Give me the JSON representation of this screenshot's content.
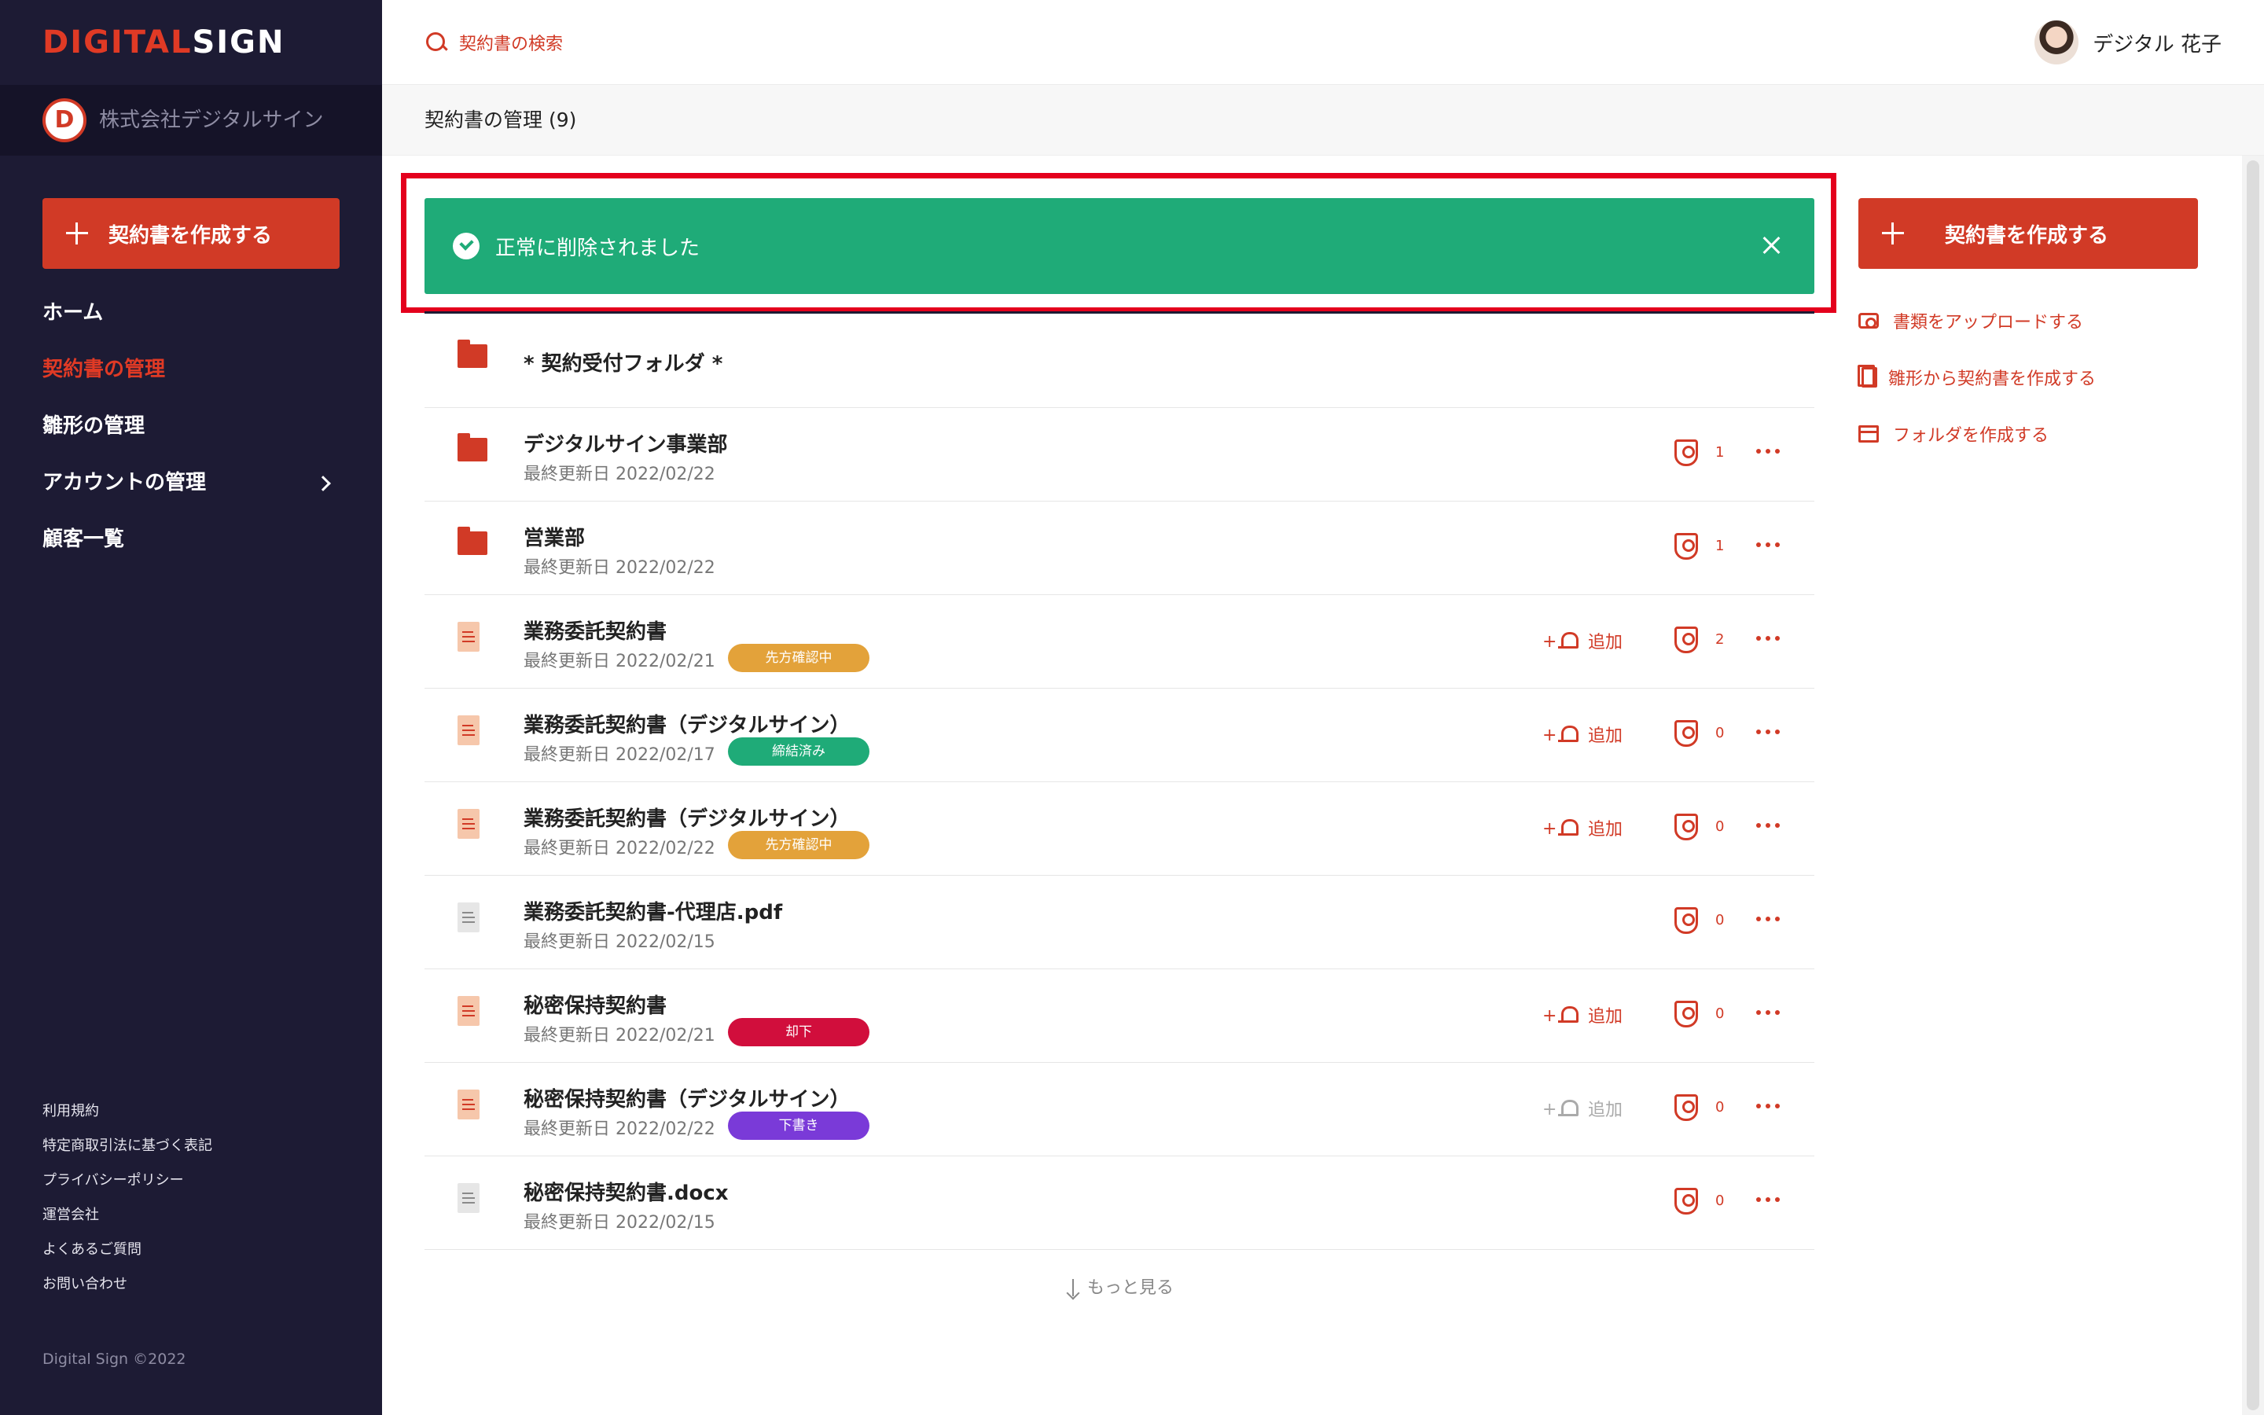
{
  "brand": {
    "logo_part1": "DIGITAL",
    "logo_part2": "SIGN"
  },
  "org": {
    "initial": "D",
    "name": "株式会社デジタルサイン"
  },
  "sidebar": {
    "create_label": "契約書を作成する",
    "nav": [
      {
        "label": "ホーム",
        "active": false
      },
      {
        "label": "契約書の管理",
        "active": true
      },
      {
        "label": "雛形の管理",
        "active": false
      },
      {
        "label": "アカウントの管理",
        "active": false,
        "has_chevron": true
      },
      {
        "label": "顧客一覧",
        "active": false
      }
    ],
    "footer_links": [
      "利用規約",
      "特定商取引法に基づく表記",
      "プライバシーポリシー",
      "運営会社",
      "よくあるご質問",
      "お問い合わせ"
    ],
    "copyright": "Digital Sign ©2022"
  },
  "topbar": {
    "search_label": "契約書の検索",
    "user_name": "デジタル 花子"
  },
  "page": {
    "title": "契約書の管理 (9)"
  },
  "alert": {
    "message": "正常に削除されました"
  },
  "list": {
    "items": [
      {
        "kind": "folder",
        "title": "* 契約受付フォルダ *"
      },
      {
        "kind": "folder",
        "title": "デジタルサイン事業部",
        "subtitle": "最終更新日 2022/02/22",
        "count": "1"
      },
      {
        "kind": "folder",
        "title": "営業部",
        "subtitle": "最終更新日 2022/02/22",
        "count": "1"
      },
      {
        "kind": "doc",
        "title": "業務委託契約書",
        "subtitle": "最終更新日 2022/02/21",
        "badge": "先方確認中",
        "badge_color": "#e3a23a",
        "alarm": "追加",
        "count": "2"
      },
      {
        "kind": "doc",
        "title": "業務委託契約書（デジタルサイン）",
        "subtitle": "最終更新日 2022/02/17",
        "badge": "締結済み",
        "badge_color": "#1fab78",
        "alarm": "追加",
        "count": "0"
      },
      {
        "kind": "doc",
        "title": "業務委託契約書（デジタルサイン）",
        "subtitle": "最終更新日 2022/02/22",
        "badge": "先方確認中",
        "badge_color": "#e3a23a",
        "alarm": "追加",
        "count": "0"
      },
      {
        "kind": "file",
        "title": "業務委託契約書-代理店.pdf",
        "subtitle": "最終更新日 2022/02/15",
        "count": "0"
      },
      {
        "kind": "doc",
        "title": "秘密保持契約書",
        "subtitle": "最終更新日 2022/02/21",
        "badge": "却下",
        "badge_color": "#d10e3c",
        "alarm": "追加",
        "count": "0"
      },
      {
        "kind": "doc",
        "title": "秘密保持契約書（デジタルサイン）",
        "subtitle": "最終更新日 2022/02/22",
        "badge": "下書き",
        "badge_color": "#7a3ad8",
        "alarm": "追加",
        "alarm_disabled": true,
        "count": "0"
      },
      {
        "kind": "file",
        "title": "秘密保持契約書.docx",
        "subtitle": "最終更新日 2022/02/15",
        "count": "0"
      }
    ],
    "load_more": "もっと見る"
  },
  "right_panel": {
    "create_label": "契約書を作成する",
    "actions": [
      {
        "label": "書類をアップロードする",
        "icon": "camera-icon"
      },
      {
        "label": "雛形から契約書を作成する",
        "icon": "template-icon"
      },
      {
        "label": "フォルダを作成する",
        "icon": "folder-icon"
      }
    ]
  },
  "colors": {
    "sidebar": "#1d1b34",
    "accent": "#d13a26",
    "success": "#1fab78",
    "highlight": "#e4001d"
  }
}
